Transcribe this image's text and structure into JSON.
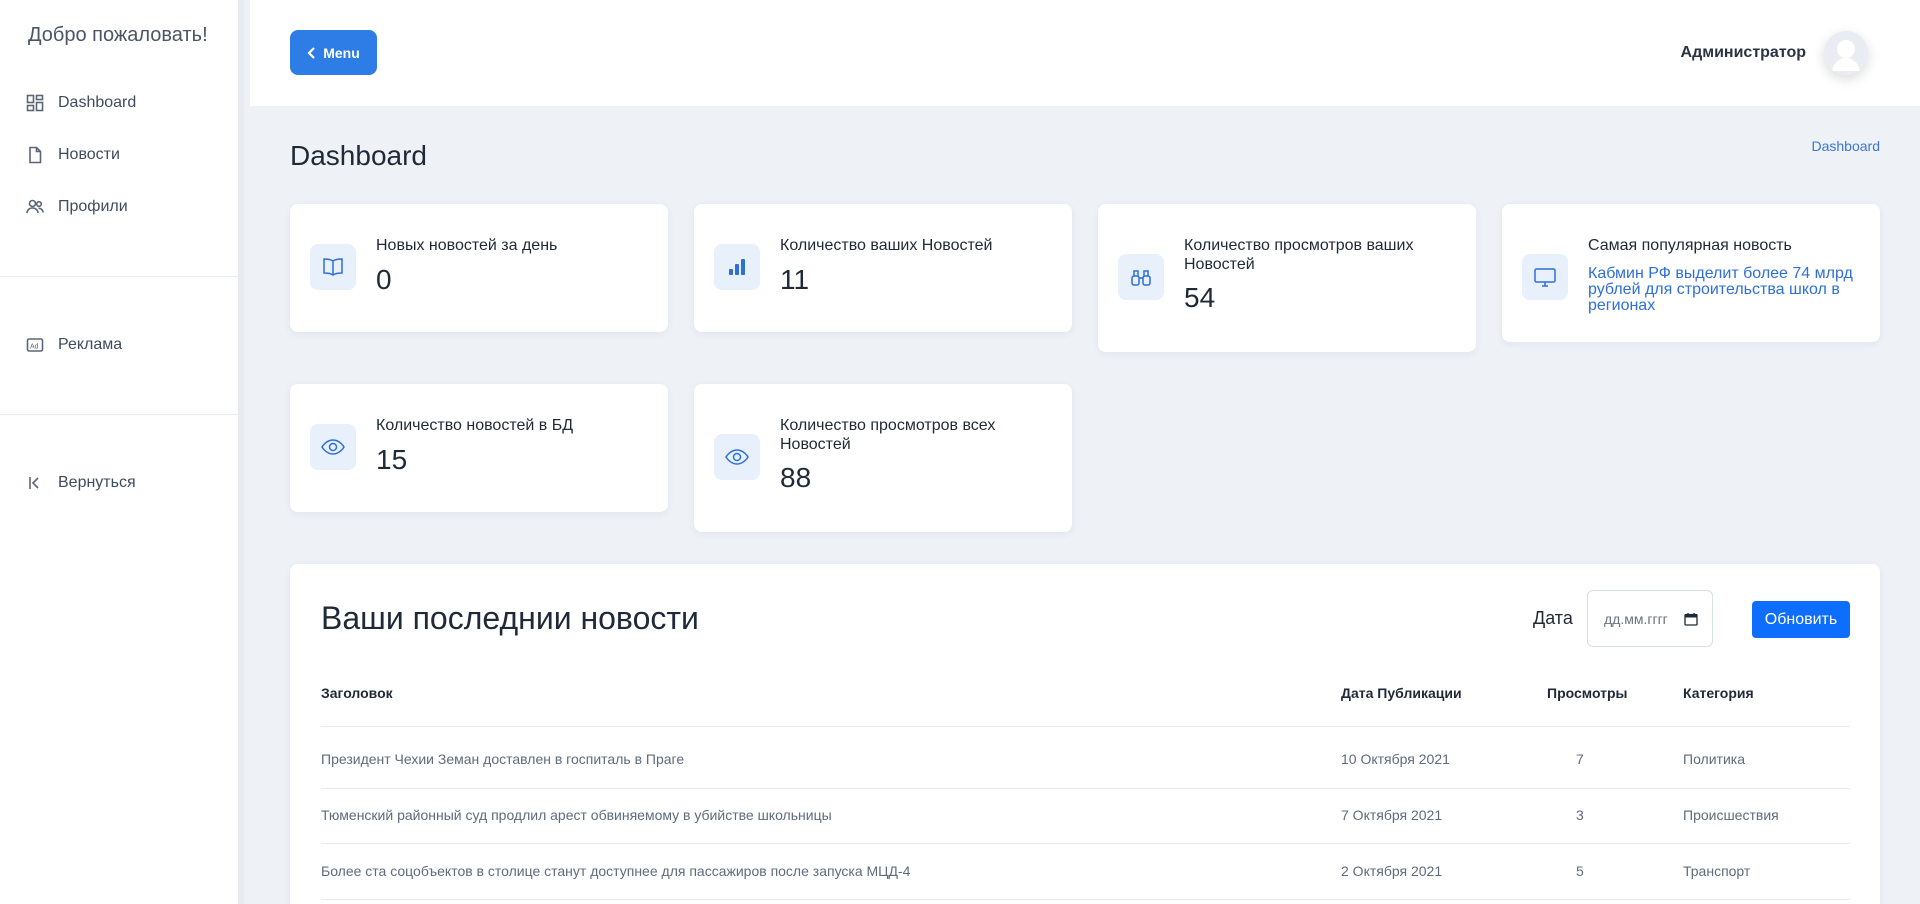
{
  "sidebar": {
    "welcome": "Добро пожаловать!",
    "items": [
      {
        "label": "Dashboard",
        "icon": "dashboard-icon"
      },
      {
        "label": "Новости",
        "icon": "file-icon"
      },
      {
        "label": "Профили",
        "icon": "users-icon"
      },
      {
        "label": "Реклама",
        "icon": "ad-icon"
      },
      {
        "label": "Вернуться",
        "icon": "collapse-left-icon"
      }
    ]
  },
  "header": {
    "menu_label": "Menu",
    "user_name": "Администратор"
  },
  "page": {
    "title": "Dashboard",
    "breadcrumb": "Dashboard"
  },
  "stats": [
    {
      "label": "Новых новостей за день",
      "value": "0",
      "icon": "book-icon"
    },
    {
      "label": "Количество ваших Новостей",
      "value": "11",
      "icon": "bar-chart-icon"
    },
    {
      "label": "Количество просмотров ваших Новостей",
      "value": "54",
      "icon": "binoculars-icon"
    },
    {
      "label": "Самая популярная новость",
      "link": "Кабмин РФ выделит более 74 млрд рублей для строительства школ в регионах",
      "icon": "monitor-icon"
    },
    {
      "label": "Количество новостей в БД",
      "value": "15",
      "icon": "eye-icon"
    },
    {
      "label": "Количество просмотров всех Новостей",
      "value": "88",
      "icon": "eye-icon"
    }
  ],
  "news": {
    "title": "Ваши последнии новости",
    "date_label": "Дата",
    "date_placeholder": "дд.мм.гггг",
    "refresh_label": "Обновить",
    "columns": [
      "Заголовок",
      "Дата Публикации",
      "Просмотры",
      "Категория"
    ],
    "rows": [
      {
        "title": "Президент Чехии Земан доставлен в госпиталь в Праге",
        "date": "10 Октября 2021",
        "views": "7",
        "category": "Политика"
      },
      {
        "title": "Тюменский районный суд продлил арест обвиняемому в убийстве школьницы",
        "date": "7 Октября 2021",
        "views": "3",
        "category": "Происшествия"
      },
      {
        "title": "Более ста соцобъектов в столице станут доступнее для пассажиров после запуска МЦД-4",
        "date": "2 Октября 2021",
        "views": "5",
        "category": "Транспорт"
      }
    ]
  },
  "colors": {
    "accent": "#2e7ce6",
    "primary_button": "#0d6efd",
    "background": "#eef2f7",
    "link": "#2e6fd8"
  }
}
